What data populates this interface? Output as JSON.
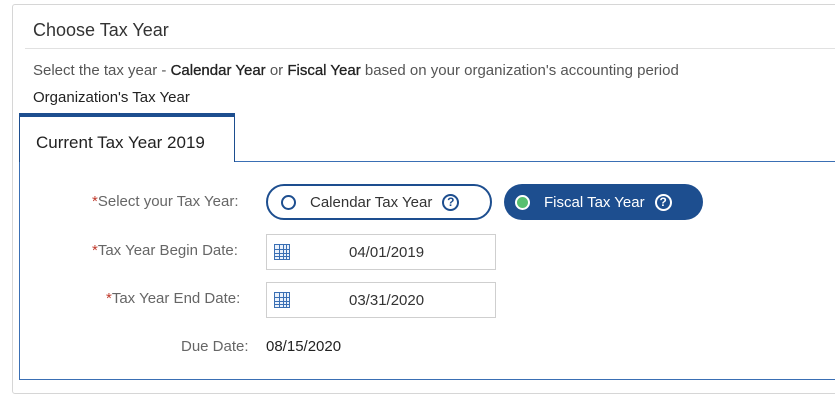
{
  "panel": {
    "title": "Choose Tax Year",
    "description": {
      "prefix": "Select the tax year - ",
      "option_a": "Calendar Year",
      "middle": " or ",
      "option_b": "Fiscal Year",
      "suffix": " based on your organization's accounting period"
    },
    "org_label": "Organization's Tax Year"
  },
  "tab": {
    "label": "Current Tax Year 2019"
  },
  "form": {
    "required_mark": "*",
    "tax_year_label": "Select your Tax Year:",
    "options": [
      {
        "label": "Calendar Tax Year",
        "selected": false,
        "help": "?"
      },
      {
        "label": "Fiscal Tax Year",
        "selected": true,
        "help": "?"
      }
    ],
    "begin_label": "Tax Year Begin Date:",
    "begin_value": "04/01/2019",
    "end_label": "Tax Year End Date:",
    "end_value": "03/31/2020",
    "due_label": "Due Date:",
    "due_value": "08/15/2020"
  },
  "colors": {
    "accent": "#1d4e8f",
    "selected_dot": "#58c070",
    "required": "#c0392b"
  }
}
